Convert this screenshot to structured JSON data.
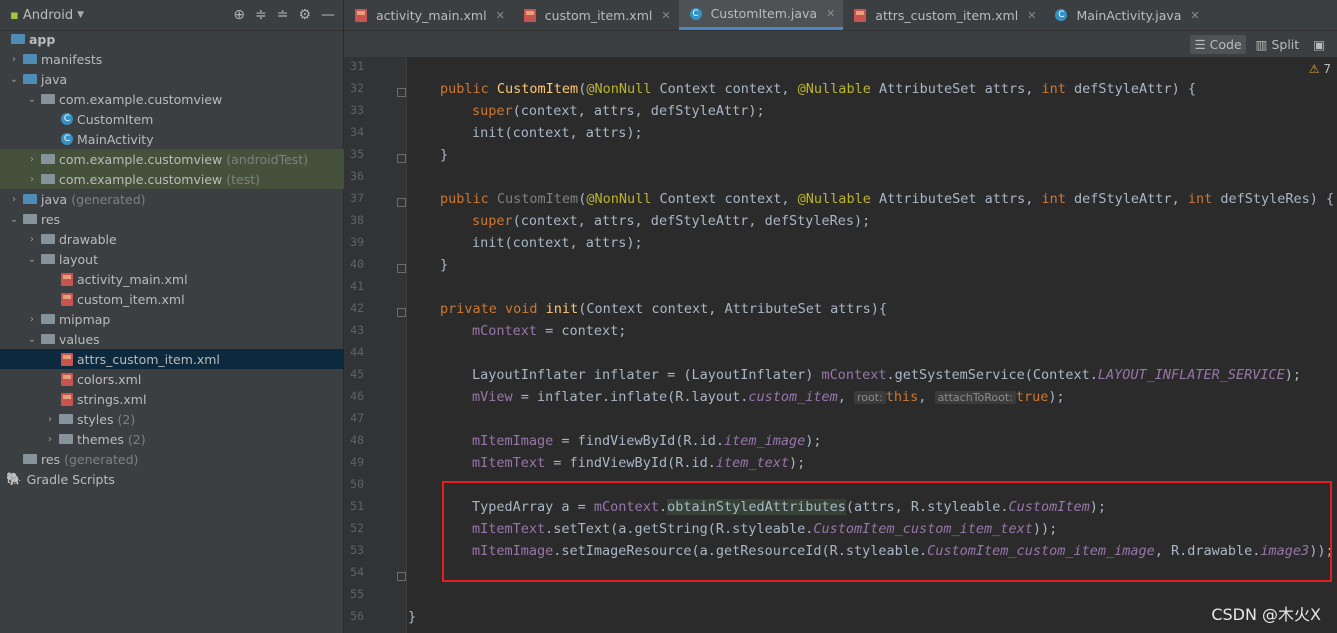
{
  "sidebar": {
    "title": "Android",
    "items": [
      {
        "label": "app",
        "suffix": ""
      },
      {
        "label": "manifests",
        "suffix": ""
      },
      {
        "label": "java",
        "suffix": ""
      },
      {
        "label": "com.example.customview",
        "suffix": ""
      },
      {
        "label": "CustomItem",
        "suffix": ""
      },
      {
        "label": "MainActivity",
        "suffix": ""
      },
      {
        "label": "com.example.customview",
        "suffix": "(androidTest)"
      },
      {
        "label": "com.example.customview",
        "suffix": "(test)"
      },
      {
        "label": "java",
        "suffix": "(generated)"
      },
      {
        "label": "res",
        "suffix": ""
      },
      {
        "label": "drawable",
        "suffix": ""
      },
      {
        "label": "layout",
        "suffix": ""
      },
      {
        "label": "activity_main.xml",
        "suffix": ""
      },
      {
        "label": "custom_item.xml",
        "suffix": ""
      },
      {
        "label": "mipmap",
        "suffix": ""
      },
      {
        "label": "values",
        "suffix": ""
      },
      {
        "label": "attrs_custom_item.xml",
        "suffix": ""
      },
      {
        "label": "colors.xml",
        "suffix": ""
      },
      {
        "label": "strings.xml",
        "suffix": ""
      },
      {
        "label": "styles",
        "suffix": "(2)"
      },
      {
        "label": "themes",
        "suffix": "(2)"
      },
      {
        "label": "res",
        "suffix": "(generated)"
      },
      {
        "label": "Gradle Scripts",
        "suffix": ""
      }
    ]
  },
  "tabs": [
    "activity_main.xml",
    "custom_item.xml",
    "CustomItem.java",
    "attrs_custom_item.xml",
    "MainActivity.java"
  ],
  "modes": {
    "code": "Code",
    "split": "Split"
  },
  "warnings": "7",
  "line_numbers": [
    "31",
    "32",
    "33",
    "34",
    "35",
    "36",
    "37",
    "38",
    "39",
    "40",
    "41",
    "42",
    "43",
    "44",
    "45",
    "46",
    "47",
    "48",
    "49",
    "50",
    "51",
    "52",
    "53",
    "54",
    "55",
    "56"
  ],
  "code": {
    "l32": {
      "kw": "public ",
      "fn": "CustomItem",
      "p1": "(",
      "an1": "@NonNull",
      "p2": " Context context, ",
      "an2": "@Nullable",
      "p3": " AttributeSet attrs, ",
      "kw2": "int",
      "p4": " defStyleAttr) {"
    },
    "l33": {
      "kw": "super",
      "rest": "(context, attrs, defStyleAttr);"
    },
    "l34": "init(context, attrs);",
    "l35": "}",
    "l37": {
      "kw": "public ",
      "fn": "CustomItem",
      "p1": "(",
      "an1": "@NonNull",
      "p2": " Context context, ",
      "an2": "@Nullable",
      "p3": " AttributeSet attrs, ",
      "kw2": "int",
      "p4": " defStyleAttr, ",
      "kw3": "int",
      "p5": " defStyleRes) {"
    },
    "l38": {
      "kw": "super",
      "rest": "(context, attrs, defStyleAttr, defStyleRes);"
    },
    "l39": "init(context, attrs);",
    "l40": "}",
    "l42": {
      "kw": "private void ",
      "fn": "init",
      "rest": "(Context context, AttributeSet attrs){"
    },
    "l43": {
      "pf": "mContext",
      "rest": " = context;"
    },
    "l45": {
      "a": "LayoutInflater inflater = (LayoutInflater) ",
      "pf": "mContext",
      "b": ".getSystemService(Context.",
      "it": "LAYOUT_INFLATER_SERVICE",
      "c": ");"
    },
    "l46": {
      "pf": "mView",
      "a": " = inflater.inflate(R.layout.",
      "it": "custom_item",
      "b": ", ",
      "h1": "root:",
      "kw1": "this",
      "c": ", ",
      "h2": "attachToRoot:",
      "kw2": "true",
      "d": ");"
    },
    "l48": {
      "pf": "mItemImage",
      "a": " = findViewById(R.id.",
      "it": "item_image",
      "b": ");"
    },
    "l49": {
      "pf": "mItemText",
      "a": " = findViewById(R.id.",
      "it": "item_text",
      "b": ");"
    },
    "l51": {
      "a": "TypedArray a = ",
      "pf": "mContext",
      "b": ".",
      "hl": "obtainStyledAttributes",
      "c": "(attrs, R.styleable.",
      "it": "CustomItem",
      "d": ");"
    },
    "l52": {
      "pf": "mItemText",
      "a": ".setText(a.getString(R.styleable.",
      "it": "CustomItem_custom_item_text",
      "b": "));"
    },
    "l53": {
      "pf": "mItemImage",
      "a": ".setImageResource(a.getResourceId(R.styleable.",
      "it": "CustomItem_custom_item_image",
      "b": ", R.drawable.",
      "it2": "image3",
      "c": "));"
    },
    "l56": "}"
  },
  "watermark": "CSDN @木火X"
}
